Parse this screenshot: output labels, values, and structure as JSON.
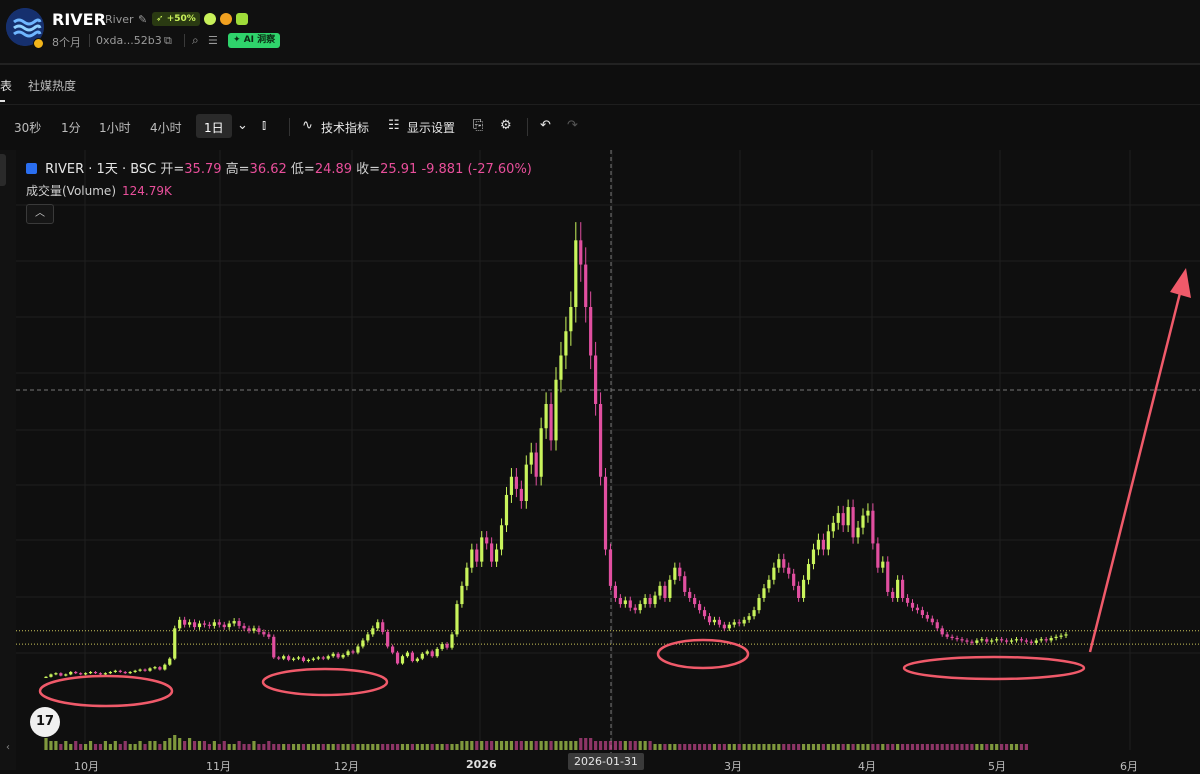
{
  "header": {
    "symbol": "RIVER",
    "name": "River",
    "boost_badge": "+50%",
    "age": "8个月",
    "address": "0xda...52b3",
    "ai_badge": "AI 洞察"
  },
  "tabs": {
    "current_fragment": "表",
    "social": "社媒热度"
  },
  "toolbar": {
    "timeframes": [
      "30秒",
      "1分",
      "1小时",
      "4小时"
    ],
    "active_timeframe": "1日",
    "indicators": "技术指标",
    "display_settings": "显示设置"
  },
  "legend": {
    "title": "RIVER · 1天 · BSC",
    "open_label": "开=",
    "open": "35.79",
    "high_label": "高=",
    "high": "36.62",
    "low_label": "低=",
    "low": "24.89",
    "close_label": "收=",
    "close": "25.91",
    "change": "-9.881 (-27.60%)",
    "volume_label": "成交量(Volume)",
    "volume": "124.79K"
  },
  "crosshair_date": "2026-01-31",
  "colors": {
    "up": "#c9f45c",
    "down": "#e14fa0",
    "annotation": "#f05a6a",
    "grid": "#1f1f1f"
  },
  "chart_data": {
    "type": "candlestick",
    "x_axis_labels": [
      "10月",
      "11月",
      "12月",
      "2026",
      "3月",
      "4月",
      "5月",
      "6月"
    ],
    "y_range": [
      0,
      40
    ],
    "series": [
      {
        "name": "price",
        "close": [
          1.5,
          1.7,
          1.8,
          1.6,
          1.7,
          1.9,
          1.8,
          1.7,
          1.8,
          1.9,
          1.8,
          1.7,
          1.8,
          1.9,
          2.0,
          1.9,
          1.8,
          1.9,
          2.0,
          2.1,
          2.0,
          2.2,
          2.3,
          2.1,
          2.5,
          3.0,
          5.5,
          6.2,
          5.8,
          6.0,
          5.6,
          5.9,
          5.8,
          5.7,
          6.0,
          5.8,
          5.6,
          5.9,
          6.1,
          5.7,
          5.5,
          5.3,
          5.5,
          5.2,
          5.0,
          4.8,
          3.1,
          3.0,
          3.2,
          2.9,
          3.0,
          3.1,
          2.8,
          2.9,
          3.0,
          3.1,
          3.0,
          3.2,
          3.4,
          3.1,
          3.3,
          3.6,
          3.5,
          4.0,
          4.5,
          5.0,
          5.5,
          6.0,
          5.2,
          4.0,
          3.5,
          2.6,
          3.2,
          3.5,
          2.8,
          3.0,
          3.4,
          3.6,
          3.2,
          3.8,
          4.2,
          3.9,
          5.0,
          7.5,
          9.0,
          10.5,
          12.0,
          11.0,
          13.0,
          12.5,
          11.0,
          12.0,
          14.0,
          16.5,
          18.0,
          17.0,
          16.0,
          19.0,
          20.0,
          18.0,
          22.0,
          24.0,
          21.0,
          26.0,
          28.0,
          30.0,
          32.0,
          37.5,
          35.5,
          32.0,
          28.0,
          24.0,
          18.0,
          12.0,
          9.0,
          8.0,
          7.5,
          7.8,
          7.2,
          7.0,
          7.5,
          8.0,
          7.5,
          8.2,
          9.0,
          8.0,
          9.5,
          10.5,
          9.8,
          8.5,
          8.0,
          7.5,
          7.0,
          6.5,
          6.0,
          6.2,
          5.8,
          5.5,
          5.8,
          6.0,
          5.9,
          6.2,
          6.5,
          7.0,
          8.0,
          8.8,
          9.5,
          10.5,
          11.2,
          10.5,
          10.0,
          9.0,
          8.0,
          9.5,
          10.8,
          12.0,
          12.8,
          12.0,
          13.5,
          14.2,
          15.0,
          14.0,
          15.5,
          13.0,
          13.8,
          14.8,
          15.2,
          12.5,
          10.5,
          11.0,
          8.5,
          8.0,
          9.5,
          8.0,
          7.6,
          7.2,
          7.0,
          6.6,
          6.3,
          6.0,
          5.5,
          5.0,
          4.8,
          4.7,
          4.6,
          4.5,
          4.4,
          4.3,
          4.5,
          4.6,
          4.4,
          4.5,
          4.6,
          4.5,
          4.4,
          4.5,
          4.6,
          4.5,
          4.4,
          4.3,
          4.5,
          4.6,
          4.5,
          4.7,
          4.8,
          4.9,
          5.0
        ],
        "volume": [
          4,
          3,
          3,
          2,
          3,
          2,
          3,
          2,
          2,
          3,
          2,
          2,
          3,
          2,
          3,
          2,
          3,
          2,
          2,
          3,
          2,
          3,
          3,
          2,
          3,
          4,
          5,
          4,
          3,
          4,
          3,
          3,
          3,
          2,
          3,
          2,
          3,
          2,
          2,
          3,
          2,
          2,
          3,
          2,
          2,
          3,
          2,
          2,
          2,
          2,
          2,
          2,
          2,
          2,
          2,
          2,
          2,
          2,
          2,
          2,
          2,
          2,
          2,
          2,
          2,
          2,
          2,
          2,
          2,
          2,
          2,
          2,
          2,
          2,
          2,
          2,
          2,
          2,
          2,
          2,
          2,
          2,
          2,
          2,
          3,
          3,
          3,
          3,
          3,
          3,
          3,
          3,
          3,
          3,
          3,
          3,
          3,
          3,
          3,
          3,
          3,
          3,
          3,
          3,
          3,
          3,
          3,
          3,
          4,
          4,
          4,
          3,
          3,
          3,
          3,
          3,
          3,
          3,
          3,
          3,
          3,
          3,
          3,
          2,
          2,
          2,
          2,
          2,
          2,
          2,
          2,
          2,
          2,
          2,
          2,
          2,
          2,
          2,
          2,
          2,
          2,
          2,
          2,
          2,
          2,
          2,
          2,
          2,
          2,
          2,
          2,
          2,
          2,
          2,
          2,
          2,
          2,
          2,
          2,
          2,
          2,
          2,
          2,
          2,
          2,
          2,
          2,
          2,
          2,
          2,
          2,
          2,
          2,
          2,
          2,
          2,
          2,
          2,
          2,
          2,
          2,
          2,
          2,
          2,
          2,
          2,
          2,
          2,
          2,
          2,
          2,
          2,
          2,
          2,
          2,
          2,
          2,
          2,
          2
        ]
      }
    ],
    "annotations": [
      "circles around four low-volatility consolidation ranges",
      "red arrow pointing up to the right"
    ]
  }
}
